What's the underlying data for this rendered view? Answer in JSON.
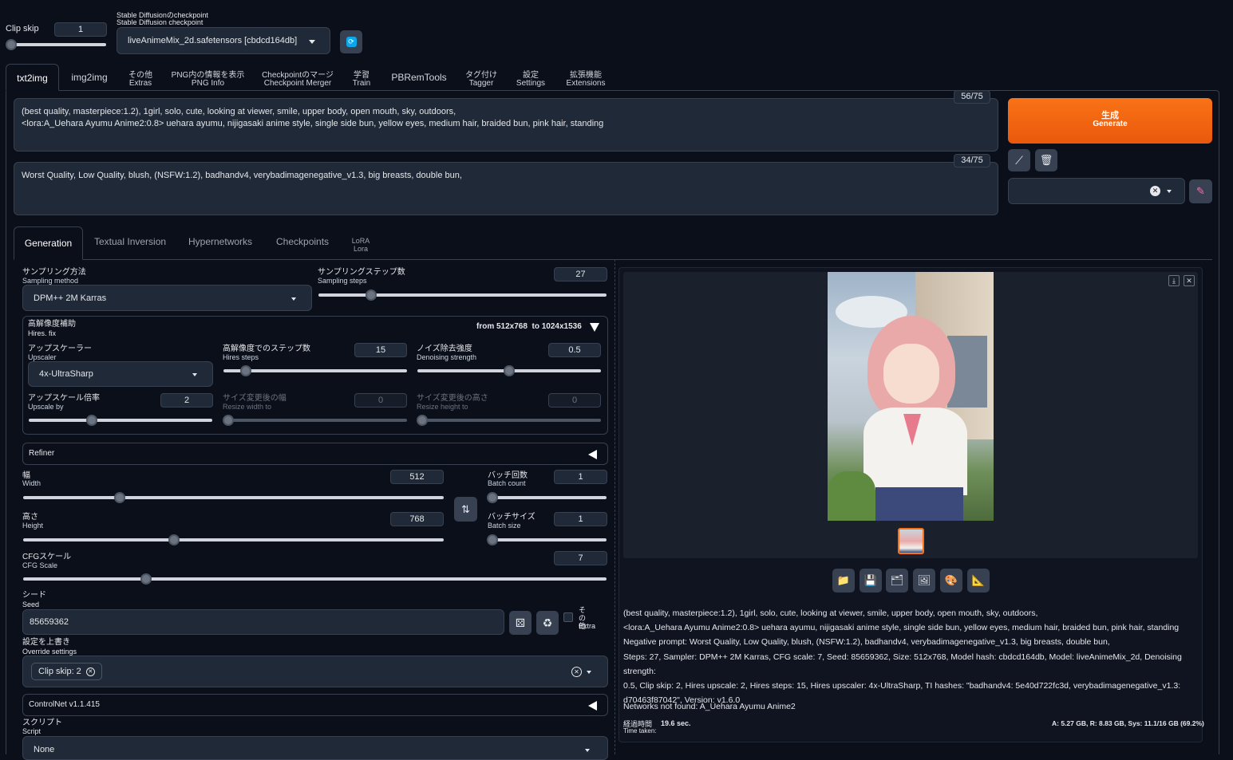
{
  "top": {
    "clip_label": "Clip skip",
    "clip_value": "1",
    "ckpt_label_jp": "Stable Diffusionのcheckpoint",
    "ckpt_label_en": "Stable Diffusion checkpoint",
    "ckpt_value": "liveAnimeMix_2d.safetensors [cbdcd164db]",
    "refresh_icon": "refresh-icon"
  },
  "tabs": {
    "txt2img": "txt2img",
    "img2img": "img2img",
    "extras_jp": "その他",
    "extras_en": "Extras",
    "pnginfo_jp": "PNG内の情報を表示",
    "pnginfo_en": "PNG Info",
    "merger_jp": "Checkpointのマージ",
    "merger_en": "Checkpoint Merger",
    "train_jp": "学習",
    "train_en": "Train",
    "pbrem": "PBRemTools",
    "tagger_jp": "タグ付け",
    "tagger_en": "Tagger",
    "settings_jp": "設定",
    "settings_en": "Settings",
    "ext_jp": "拡張機能",
    "ext_en": "Extensions"
  },
  "prompt": {
    "text1": "(best quality, masterpiece:1.2), 1girl, solo, cute, looking at viewer, smile, upper body, open mouth, sky, outdoors,",
    "text2": "<lora:A_Uehara Ayumu Anime2:0.8> uehara ayumu, nijigasaki anime style, single side bun, yellow eyes, medium hair, braided bun, pink hair, standing",
    "count": "56/75"
  },
  "neg_prompt": {
    "text": "Worst Quality, Low Quality, blush, (NSFW:1.2), badhandv4, verybadimagenegative_v1.3, big breasts, double bun,",
    "count": "34/75"
  },
  "generate": {
    "jp": "生成",
    "en": "Generate",
    "accent": "#f97316"
  },
  "subtabs": {
    "generation": "Generation",
    "textual": "Textual Inversion",
    "hyper": "Hypernetworks",
    "checkpoints": "Checkpoints",
    "lora1": "LoRA",
    "lora2": "Lora"
  },
  "sampling": {
    "method_jp": "サンプリング方法",
    "method_en": "Sampling method",
    "method_value": "DPM++ 2M Karras",
    "steps_jp": "サンプリングステップ数",
    "steps_en": "Sampling steps",
    "steps_value": "27",
    "steps_level": 0.18
  },
  "hires": {
    "title_jp": "高解像度補助",
    "title_en": "Hires. fix",
    "summary": "from 512x768  to 1024x1536",
    "upscaler_jp": "アップスケーラー",
    "upscaler_en": "Upscaler",
    "upscaler_value": "4x-UltraSharp",
    "hsteps_jp": "高解像度でのステップ数",
    "hsteps_en": "Hires steps",
    "hsteps_value": "15",
    "denoise_jp": "ノイズ除去強度",
    "denoise_en": "Denoising strength",
    "denoise_value": "0.5",
    "upby_jp": "アップスケール倍率",
    "upby_en": "Upscale by",
    "upby_value": "2",
    "rw_jp": "サイズ変更後の幅",
    "rw_en": "Resize width to",
    "rw_value": "0",
    "rh_jp": "サイズ変更後の高さ",
    "rh_en": "Resize height to",
    "rh_value": "0"
  },
  "refiner": {
    "label": "Refiner"
  },
  "size": {
    "width_jp": "幅",
    "width_en": "Width",
    "width_value": "512",
    "height_jp": "高さ",
    "height_en": "Height",
    "height_value": "768",
    "bc_jp": "バッチ回数",
    "bc_en": "Batch count",
    "bc_value": "1",
    "bs_jp": "バッチサイズ",
    "bs_en": "Batch size",
    "bs_value": "1",
    "cfg_jp": "CFGスケール",
    "cfg_en": "CFG Scale",
    "cfg_value": "7"
  },
  "seed": {
    "label_jp": "シード",
    "label_en": "Seed",
    "value": "85659362",
    "extra_jp": "その他",
    "extra_en": "Extra"
  },
  "override": {
    "label_jp": "設定を上書き",
    "label_en": "Override settings",
    "chip": "Clip skip: 2"
  },
  "controlnet": {
    "label": "ControlNet v1.1.415"
  },
  "script": {
    "label_jp": "スクリプト",
    "label_en": "Script",
    "value": "None"
  },
  "output": {
    "line1": "(best quality, masterpiece:1.2), 1girl, solo, cute, looking at viewer, smile, upper body, open mouth, sky, outdoors,",
    "line2": "<lora:A_Uehara Ayumu Anime2:0.8> uehara ayumu, nijigasaki anime style, single side bun, yellow eyes, medium hair, braided bun, pink hair, standing",
    "line3": "Negative prompt: Worst Quality, Low Quality, blush, (NSFW:1.2), badhandv4, verybadimagenegative_v1.3, big breasts, double bun,",
    "line4": "Steps: 27, Sampler: DPM++ 2M Karras, CFG scale: 7, Seed: 85659362, Size: 512x768, Model hash: cbdcd164db, Model: liveAnimeMix_2d, Denoising strength:",
    "line5": "0.5, Clip skip: 2, Hires upscale: 2, Hires steps: 15, Hires upscaler: 4x-UltraSharp, TI hashes: \"badhandv4: 5e40d722fc3d, verybadimagenegative_v1.3:",
    "line6": "d70463f87042\", Version: v1.6.0",
    "networks": "Networks not found: A_Uehara Ayumu Anime2",
    "time_jp": "経過時間",
    "time_en": "Time taken:",
    "time_value": "19.6 sec.",
    "mem": "A: 5.27 GB, R: 8.83 GB, Sys: 11.1/16 GB (69.2%)"
  }
}
